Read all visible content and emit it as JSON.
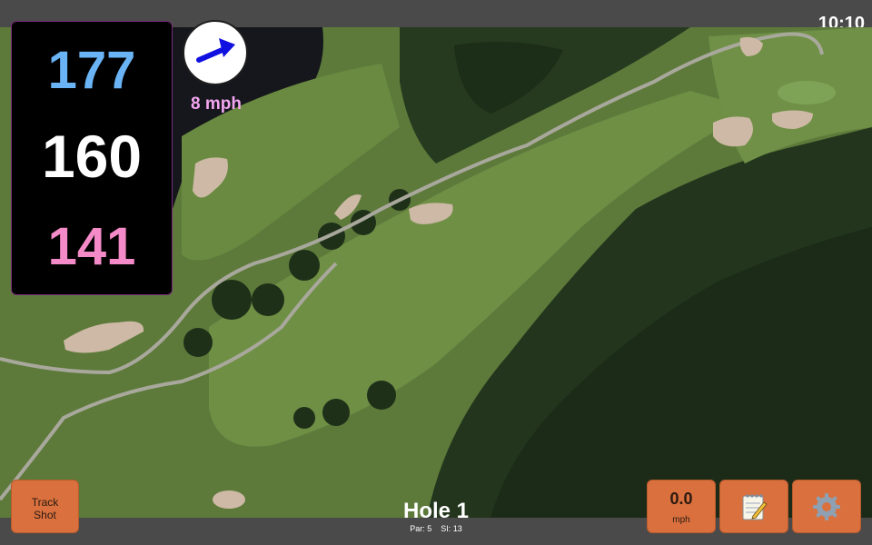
{
  "status_bar": {
    "time": "10:10"
  },
  "distances": {
    "back": "177",
    "middle": "160",
    "front": "141"
  },
  "wind": {
    "speed": "8 mph",
    "direction_icon": "arrow-icon"
  },
  "buttons": {
    "track_shot_line1": "Track",
    "track_shot_line2": "Shot",
    "speed_value": "0.0",
    "speed_unit": "mph",
    "notes_icon": "notepad-icon",
    "settings_icon": "gear-icon"
  },
  "hole": {
    "title": "Hole 1",
    "par": "Par: 5",
    "stroke_index": "SI: 13"
  },
  "colors": {
    "back_distance": "#6ab4f5",
    "middle_distance": "#ffffff",
    "front_distance": "#f48ac7",
    "wind_text": "#f3a6f0",
    "button": "#d9703e",
    "bars": "#4a4a4a"
  }
}
